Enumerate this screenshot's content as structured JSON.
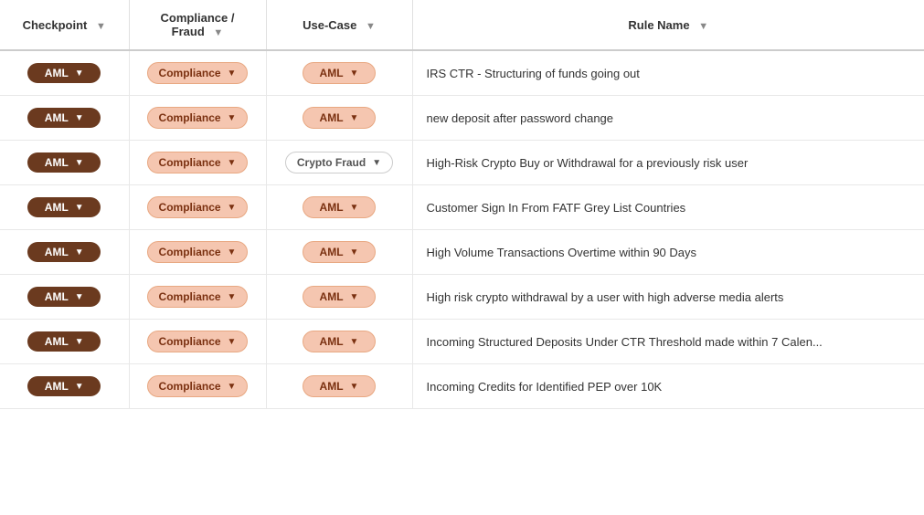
{
  "header": {
    "cols": [
      {
        "id": "checkpoint",
        "label": "Checkpoint",
        "filter": true
      },
      {
        "id": "compliance",
        "label": "Compliance /\nFraud",
        "filter": true
      },
      {
        "id": "usecase",
        "label": "Use-Case",
        "filter": true
      },
      {
        "id": "rulename",
        "label": "Rule Name",
        "filter": true
      }
    ]
  },
  "rows": [
    {
      "checkpoint": "AML",
      "compliance": "Compliance",
      "usecase": "AML",
      "usecase_type": "aml",
      "rulename": "IRS CTR - Structuring of funds going out"
    },
    {
      "checkpoint": "AML",
      "compliance": "Compliance",
      "usecase": "AML",
      "usecase_type": "aml",
      "rulename": "new deposit after password change"
    },
    {
      "checkpoint": "AML",
      "compliance": "Compliance",
      "usecase": "Crypto Fraud",
      "usecase_type": "crypto",
      "rulename": "High-Risk Crypto Buy or Withdrawal for a previously risk user"
    },
    {
      "checkpoint": "AML",
      "compliance": "Compliance",
      "usecase": "AML",
      "usecase_type": "aml",
      "rulename": "Customer Sign In From FATF Grey List Countries"
    },
    {
      "checkpoint": "AML",
      "compliance": "Compliance",
      "usecase": "AML",
      "usecase_type": "aml",
      "rulename": "High Volume Transactions Overtime within 90 Days"
    },
    {
      "checkpoint": "AML",
      "compliance": "Compliance",
      "usecase": "AML",
      "usecase_type": "aml",
      "rulename": "High risk crypto withdrawal by a user with high adverse media alerts"
    },
    {
      "checkpoint": "AML",
      "compliance": "Compliance",
      "usecase": "AML",
      "usecase_type": "aml",
      "rulename": "Incoming Structured Deposits Under CTR Threshold made within 7 Calen..."
    },
    {
      "checkpoint": "AML",
      "compliance": "Compliance",
      "usecase": "AML",
      "usecase_type": "aml",
      "rulename": "Incoming Credits for Identified PEP over 10K"
    }
  ],
  "icons": {
    "chevron_down": "▼",
    "filter": "▼"
  }
}
